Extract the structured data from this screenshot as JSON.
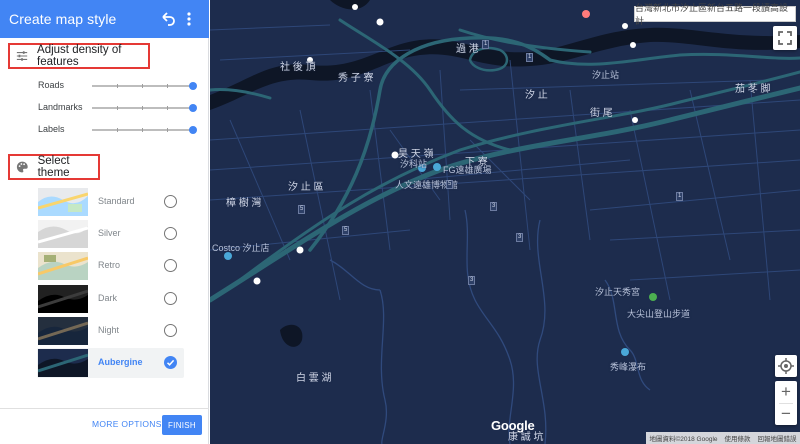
{
  "panel": {
    "title": "Create map style",
    "undo_icon": "undo-icon",
    "more_icon": "more-vert-icon",
    "density": {
      "heading": "Adjust density of features",
      "icon": "tune-icon",
      "sliders": [
        {
          "label": "Roads",
          "value": 1.0
        },
        {
          "label": "Landmarks",
          "value": 1.0
        },
        {
          "label": "Labels",
          "value": 1.0
        }
      ]
    },
    "theme": {
      "heading": "Select theme",
      "icon": "palette-icon",
      "options": [
        {
          "label": "Standard",
          "selected": false
        },
        {
          "label": "Silver",
          "selected": false
        },
        {
          "label": "Retro",
          "selected": false
        },
        {
          "label": "Dark",
          "selected": false
        },
        {
          "label": "Night",
          "selected": false
        },
        {
          "label": "Aubergine",
          "selected": true
        }
      ]
    },
    "more_options": "MORE OPTIONS",
    "finish": "FINISH"
  },
  "map": {
    "address": "台灣新北市汐止區新台五路一段讀高設計",
    "labels": {
      "she_hou_ding": "社 後 頂",
      "xiu_zi_liao": "秀 子 寮",
      "guo_dao": "過 港",
      "xizhi_station": "汐止站",
      "xizhi": "汐 止",
      "jie_wei": "街 尾",
      "nan_zhong_ba": "茄 苳 脚",
      "kang_yu": "昊 天 嶺",
      "xike_station": "汐科站",
      "fg": "FG遠雄廣場",
      "xia_she": "下 寮",
      "renwen": "人文遠雄博物館",
      "xizhi_district": "汐 止 區",
      "zhang_shu_wan": "樟 樹 灣",
      "costco": "Costco 汐止店",
      "temple": "汐止天秀宮",
      "trail": "大尖山登山步道",
      "bai_yun": "白 雲 湖",
      "waterfall": "秀峰瀑布",
      "kang_lang_keng": "康 誠 坑"
    },
    "shields": [
      "1",
      "5",
      "5",
      "5",
      "3",
      "3",
      "1",
      "3",
      "1"
    ],
    "google": "Google",
    "attribution": [
      "地圖資料©2018 Google",
      "使用條款",
      "回報地圖錯誤"
    ],
    "icons": {
      "fullscreen": "fullscreen-icon",
      "locate": "my-location-icon",
      "zoom_in": "+",
      "zoom_out": "−"
    },
    "colors": {
      "land": "#1d2c4d",
      "water": "#0e1626",
      "road": "#304a7d",
      "highway": "#2c6675",
      "accent": "#4285f4"
    }
  }
}
